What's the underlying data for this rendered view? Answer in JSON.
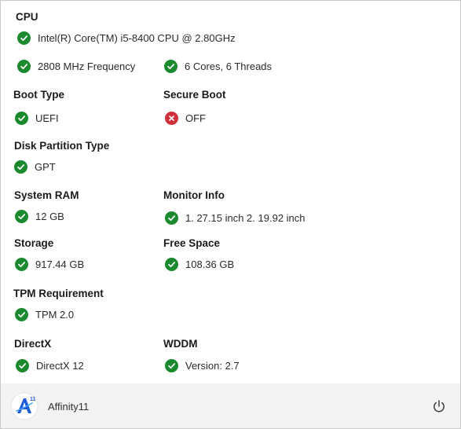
{
  "cpu": {
    "heading": "CPU",
    "model": "Intel(R) Core(TM) i5-8400 CPU @ 2.80GHz",
    "frequency": "2808 MHz Frequency",
    "cores": "6 Cores, 6 Threads"
  },
  "boot_type": {
    "heading": "Boot Type",
    "value": "UEFI",
    "status": "ok"
  },
  "secure_boot": {
    "heading": "Secure Boot",
    "value": "OFF",
    "status": "fail"
  },
  "disk_partition": {
    "heading": "Disk Partition Type",
    "value": "GPT",
    "status": "ok"
  },
  "system_ram": {
    "heading": "System RAM",
    "value": "12 GB",
    "status": "ok"
  },
  "monitor_info": {
    "heading": "Monitor Info",
    "value": "1. 27.15 inch 2. 19.92 inch",
    "status": "ok"
  },
  "storage": {
    "heading": "Storage",
    "value": "917.44 GB",
    "status": "ok"
  },
  "free_space": {
    "heading": "Free Space",
    "value": "108.36 GB",
    "status": "ok"
  },
  "tpm": {
    "heading": "TPM Requirement",
    "value": "TPM 2.0",
    "status": "ok"
  },
  "directx": {
    "heading": "DirectX",
    "value": "DirectX 12",
    "status": "ok"
  },
  "wddm": {
    "heading": "WDDM",
    "value": "Version: 2.7",
    "status": "ok"
  },
  "footer": {
    "app_name": "Affinity11",
    "logo_text": "A",
    "logo_badge": "11",
    "power_icon": "power-icon"
  },
  "colors": {
    "ok": "#1b8a2e",
    "fail": "#d0303a",
    "footer_bg": "#f3f3f3",
    "logo_blue": "#1e5bd8"
  }
}
